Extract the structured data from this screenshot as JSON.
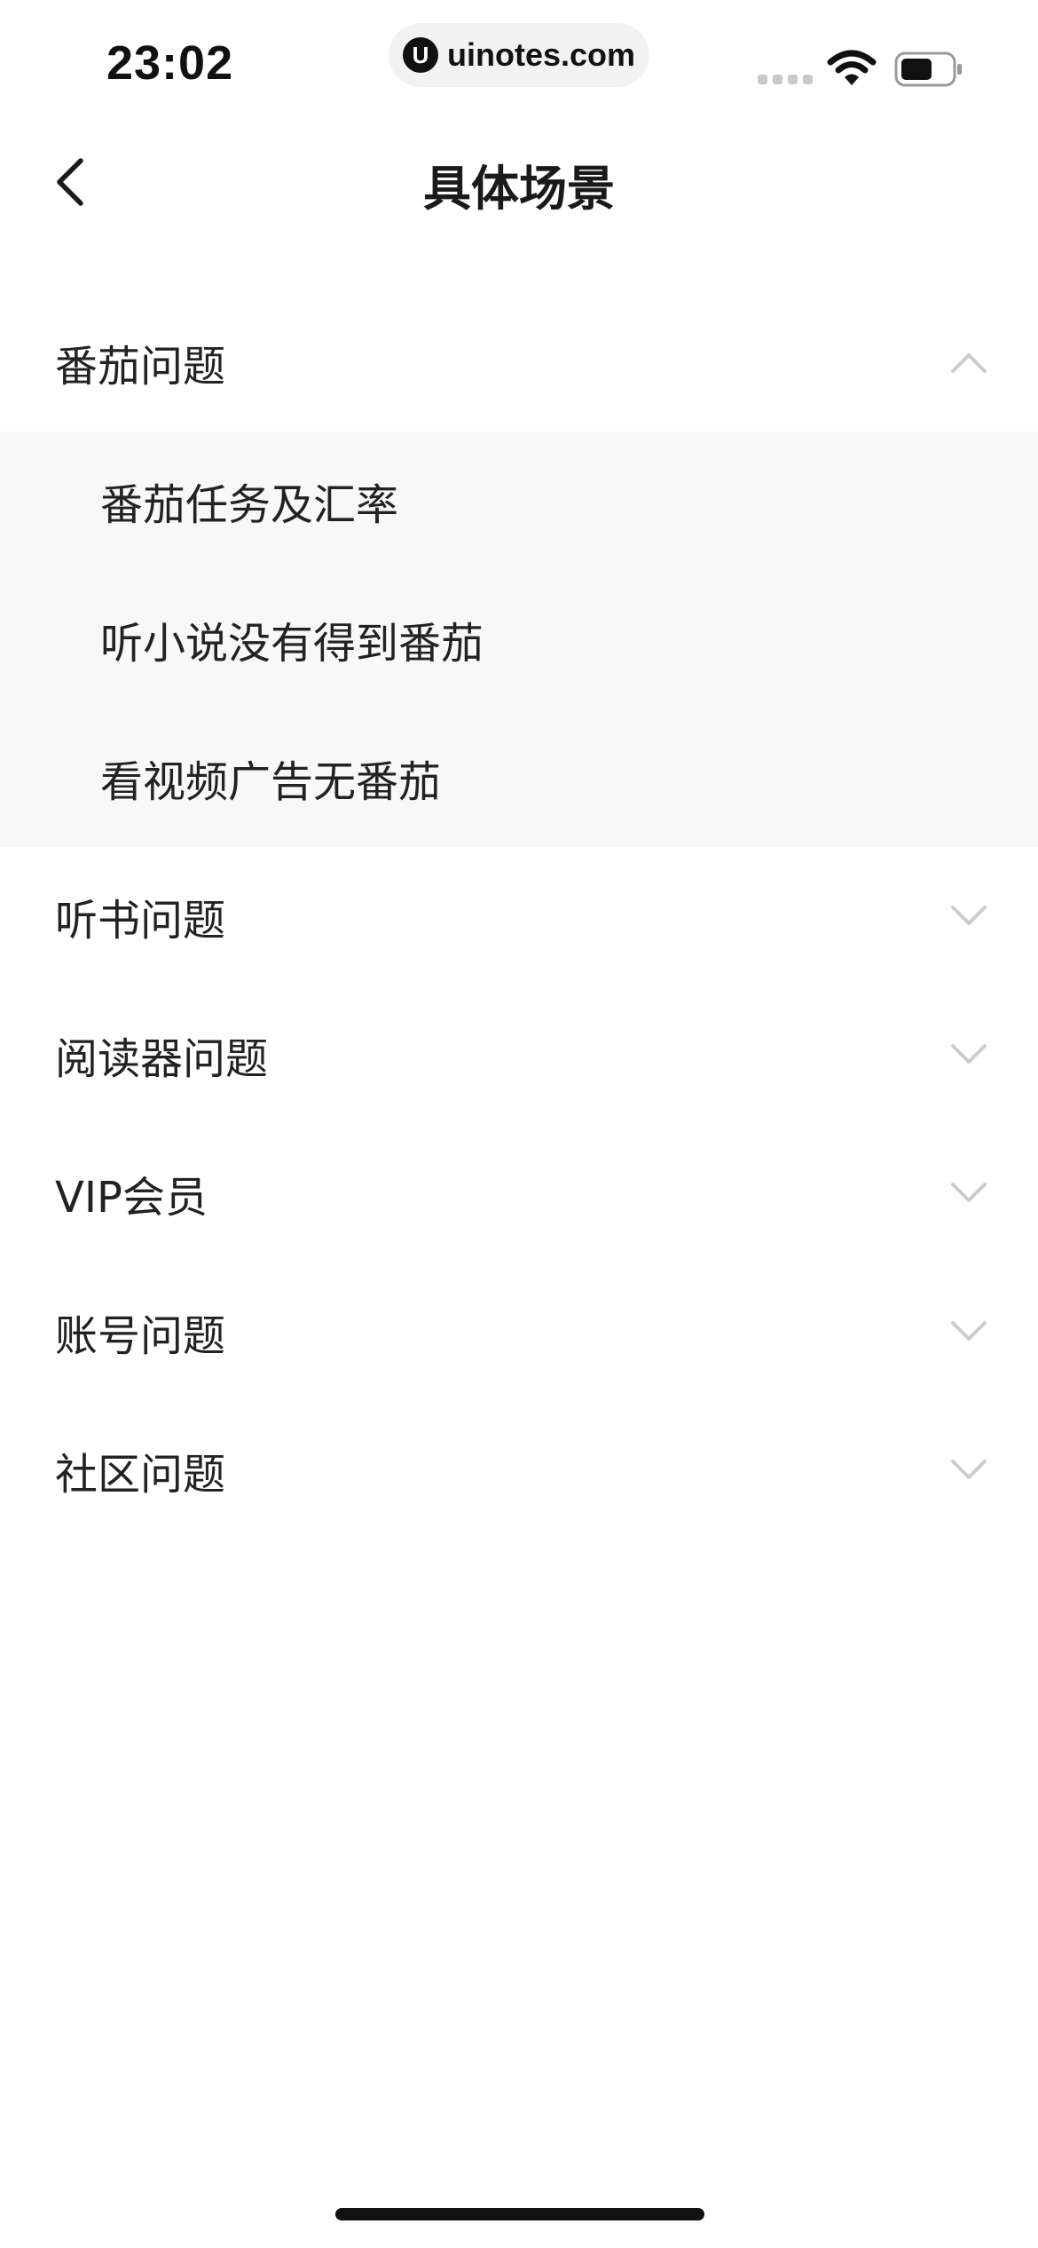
{
  "status_bar": {
    "time": "23:02",
    "url": "uinotes.com",
    "url_logo_glyph": "U",
    "icons": [
      "signal-icon",
      "wifi-icon",
      "battery-icon"
    ]
  },
  "nav": {
    "title": "具体场景",
    "back_icon": "chevron-left-icon"
  },
  "categories": [
    {
      "label": "番茄问题",
      "expanded": true,
      "items": [
        {
          "label": "番茄任务及汇率"
        },
        {
          "label": "听小说没有得到番茄"
        },
        {
          "label": "看视频广告无番茄"
        }
      ]
    },
    {
      "label": "听书问题",
      "expanded": false
    },
    {
      "label": "阅读器问题",
      "expanded": false
    },
    {
      "label": "VIP会员",
      "expanded": false
    },
    {
      "label": "账号问题",
      "expanded": false
    },
    {
      "label": "社区问题",
      "expanded": false
    }
  ],
  "colors": {
    "expanded_panel_bg": "#f8f8f8",
    "chevron": "#cccccc",
    "text": "#222222"
  }
}
